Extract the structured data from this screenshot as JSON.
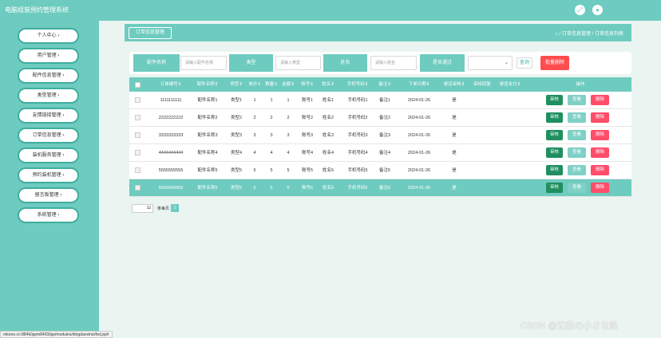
{
  "app": {
    "title": "电脑组装预约管理系统"
  },
  "top_icons": [
    "expand-icon",
    "user-icon"
  ],
  "sidebar": {
    "items": [
      {
        "label": "个人中心"
      },
      {
        "label": "用户管理"
      },
      {
        "label": "配件信息管理"
      },
      {
        "label": "类型管理"
      },
      {
        "label": "友情链接管理"
      },
      {
        "label": "订单信息管理"
      },
      {
        "label": "装机服务管理"
      },
      {
        "label": "预约装机管理"
      },
      {
        "label": "留言板管理"
      },
      {
        "label": "系统管理"
      }
    ]
  },
  "breadcrumb": {
    "button": "订单信息管理",
    "path": "⌂ / 订单信息管理 / 订单信息列表"
  },
  "search": {
    "label1": "配件名称",
    "placeholder1": "请输入配件名称",
    "label2": "类型",
    "placeholder2": "请输入类型",
    "label3": "姓名",
    "placeholder3": "请输入姓名",
    "label4": "是否通过",
    "query_button": "查询",
    "batch_delete_button": "批量删除"
  },
  "table": {
    "headers": [
      "订单编号⇕",
      "配件名称⇕",
      "类型⇕",
      "单价⇕",
      "数量⇕",
      "金额⇕",
      "账号⇕",
      "姓名⇕",
      "手机号码⇕",
      "备注⇕",
      "下单日期⇕",
      "是否审核⇕",
      "审核回复",
      "是否支付⇕",
      "操作"
    ],
    "rows": [
      {
        "id": "1111111111",
        "name": "配件名称1",
        "type": "类型1",
        "price": "1",
        "qty": "1",
        "amount": "1",
        "account": "账号1",
        "person": "姓名1",
        "phone": "手机号码1",
        "note": "备注1",
        "date": "2024-01-26",
        "approved": "是"
      },
      {
        "id": "2222222222",
        "name": "配件名称2",
        "type": "类型2",
        "price": "2",
        "qty": "2",
        "amount": "2",
        "account": "账号2",
        "person": "姓名2",
        "phone": "手机号码2",
        "note": "备注2",
        "date": "2024-01-26",
        "approved": "是"
      },
      {
        "id": "3333333333",
        "name": "配件名称3",
        "type": "类型3",
        "price": "3",
        "qty": "3",
        "amount": "3",
        "account": "账号3",
        "person": "姓名3",
        "phone": "手机号码3",
        "note": "备注3",
        "date": "2024-01-26",
        "approved": "是"
      },
      {
        "id": "4444444444",
        "name": "配件名称4",
        "type": "类型4",
        "price": "4",
        "qty": "4",
        "amount": "4",
        "account": "账号4",
        "person": "姓名4",
        "phone": "手机号码4",
        "note": "备注4",
        "date": "2024-01-26",
        "approved": "是"
      },
      {
        "id": "5555555555",
        "name": "配件名称5",
        "type": "类型5",
        "price": "5",
        "qty": "5",
        "amount": "5",
        "account": "账号5",
        "person": "姓名5",
        "phone": "手机号码5",
        "note": "备注5",
        "date": "2024-01-26",
        "approved": "是"
      },
      {
        "id": "6666666666",
        "name": "配件名称6",
        "type": "类型6",
        "price": "6",
        "qty": "6",
        "amount": "6",
        "account": "账号6",
        "person": "姓名6",
        "phone": "手机号码6",
        "note": "备注6",
        "date": "2024-01-26",
        "approved": "是"
      }
    ],
    "actions": {
      "review": "审核",
      "view": "查看",
      "delete": "删除"
    }
  },
  "pager": {
    "page_size": "10",
    "total_text": "条每页",
    "current_page": "1"
  },
  "statusbar": {
    "url": "mkone.cn:8849/jspm8493/jsp/modules/dingdanxinxi/list.jsp#"
  },
  "watermark": "CSDN @无敌の小さな敗",
  "colors": {
    "primary": "#6ecbbf",
    "danger": "#ff4d4f",
    "review": "#1f8f5f"
  }
}
